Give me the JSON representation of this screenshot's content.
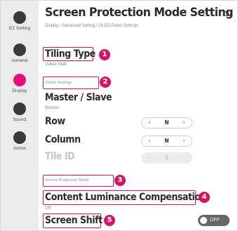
{
  "sidebar": {
    "items": [
      {
        "label": "EZ Setting",
        "active": false
      },
      {
        "label": "General",
        "active": false
      },
      {
        "label": "Display",
        "active": true
      },
      {
        "label": "Sound",
        "active": false
      },
      {
        "label": "Admin",
        "active": false
      }
    ]
  },
  "header": {
    "title": "Screen Protection Mode Setting",
    "breadcrumb": "Display / Advanced Setting / OLED Panel Settings",
    "back_icon": "back-icon"
  },
  "settings": {
    "tiling_type": {
      "label": "Tiling Type",
      "value": "Video Wall"
    },
    "detail_section": "Detail Settings",
    "master_slave": {
      "label": "Master / Slave",
      "value": "Master"
    },
    "row": {
      "label": "Row",
      "value": "N"
    },
    "column": {
      "label": "Column",
      "value": "N"
    },
    "tile_id": {
      "label": "Tile ID",
      "value": "1"
    },
    "protection_section": "Screen Protection Mode",
    "luminance": {
      "label": "Content Luminance Compensation",
      "value": "Off"
    },
    "screen_shift": {
      "label": "Screen Shift",
      "toggle": "OFF"
    }
  },
  "callouts": [
    "1",
    "2",
    "3",
    "4",
    "5"
  ],
  "colors": {
    "accent": "#d41467",
    "active_nav": "#e2127a",
    "sidebar_bg": "#ececec"
  }
}
